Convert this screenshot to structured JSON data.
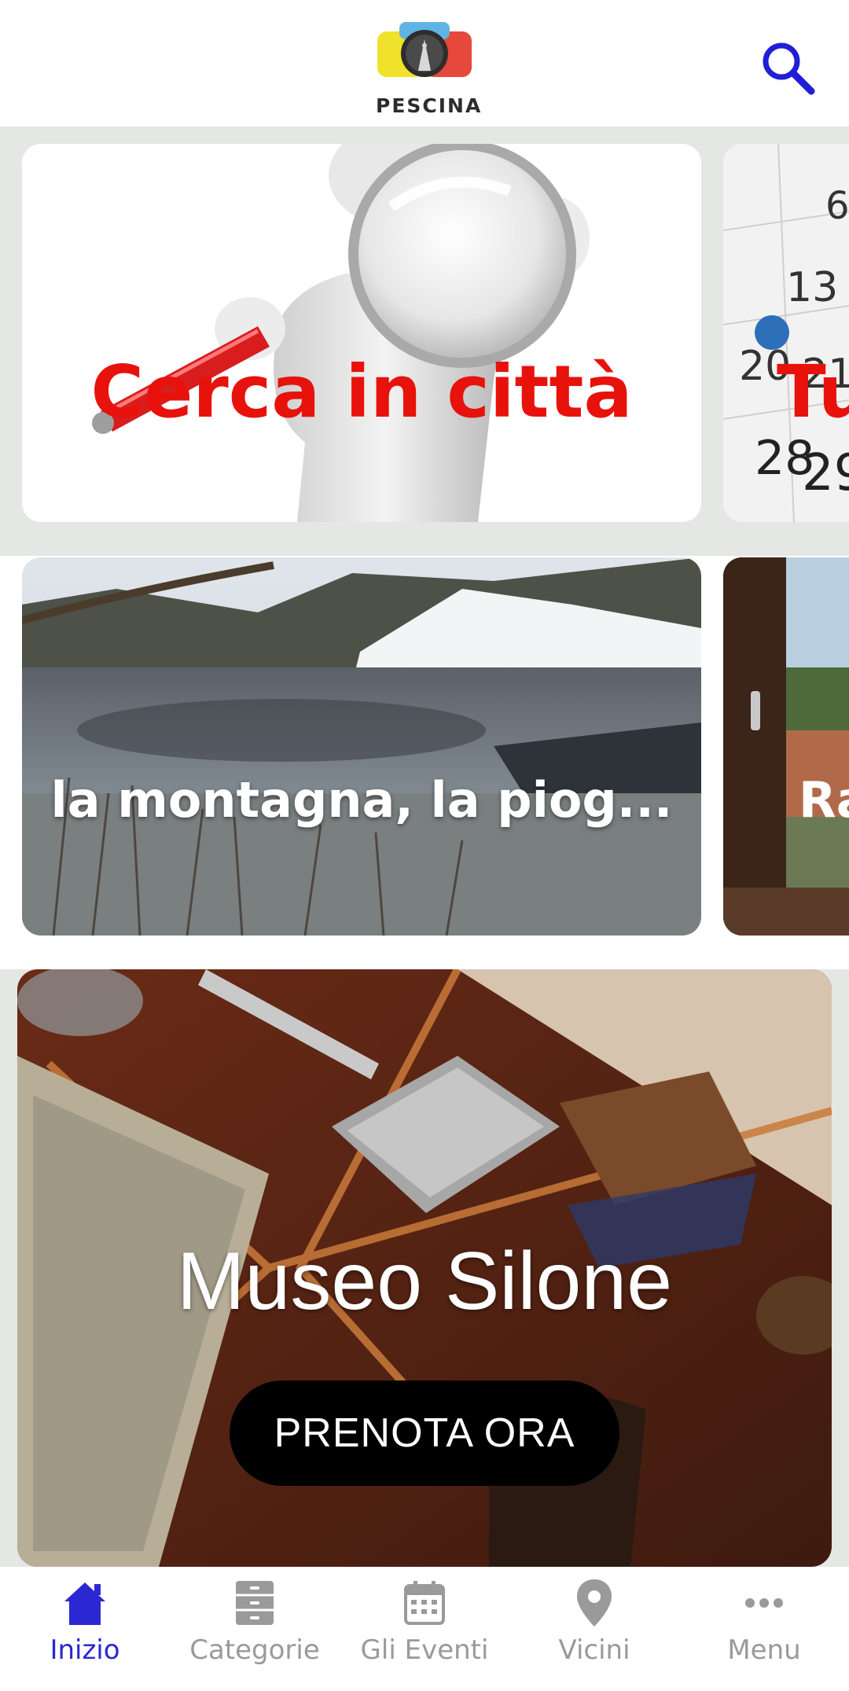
{
  "header": {
    "logo_text": "PESCINA",
    "search_icon": "search-icon",
    "accent_color": "#1f1fd6"
  },
  "carousel_primary": [
    {
      "label": "Cerca in città",
      "image": "magnifier-figure",
      "label_color": "#e8120c"
    },
    {
      "label": "Tu",
      "image": "calendar",
      "label_color": "#e8120c"
    }
  ],
  "carousel_secondary": [
    {
      "label": "la montagna, la piog...",
      "image": "frozen-lake"
    },
    {
      "label": "Ra",
      "image": "window-view"
    }
  ],
  "museum": {
    "title": "Museo Silone",
    "cta_label": "PRENOTA ORA"
  },
  "tabbar": {
    "active_color": "#2b28d3",
    "inactive_color": "#9a9a9a",
    "tabs": [
      {
        "label": "Inizio",
        "icon": "home-icon",
        "active": true
      },
      {
        "label": "Categorie",
        "icon": "cabinet-icon",
        "active": false
      },
      {
        "label": "Gli Eventi",
        "icon": "calendar-icon",
        "active": false
      },
      {
        "label": "Vicini",
        "icon": "location-pin-icon",
        "active": false
      },
      {
        "label": "Menu",
        "icon": "more-dots-icon",
        "active": false
      }
    ]
  }
}
